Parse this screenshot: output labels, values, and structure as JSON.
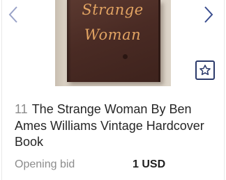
{
  "lot": {
    "number": "11",
    "title": "The Strange Woman By Ben Ames Williams Vintage Hardcover Book"
  },
  "image": {
    "cover_line_1": "Strange",
    "cover_line_2": "Woman"
  },
  "bid": {
    "label": "Opening bid",
    "amount": "1 USD"
  },
  "icons": {
    "prev": "chevron-left-icon",
    "next": "chevron-right-icon",
    "watch": "star-icon"
  },
  "colors": {
    "nav_chevron": "#3a4d8f",
    "prev_chevron": "#9aa3c8",
    "watch_border": "#2b3a6b",
    "lot_number": "#8c8c8c",
    "title_text": "#262626"
  }
}
